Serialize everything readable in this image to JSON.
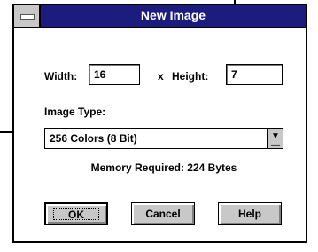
{
  "dialog": {
    "title": "New Image",
    "width": {
      "label": "Width:",
      "value": "16"
    },
    "times_sign": "x",
    "height": {
      "label": "Height:",
      "value": "7"
    },
    "image_type": {
      "label": "Image Type:",
      "selected": "256 Colors (8 Bit)"
    },
    "memory_required": "Memory Required: 224 Bytes",
    "buttons": {
      "ok": "OK",
      "cancel": "Cancel",
      "help": "Help"
    }
  },
  "icons": {
    "system_menu": "system-menu-icon",
    "dropdown": "dropdown-arrow-icon"
  },
  "colors": {
    "titlebar": "#1c1c7e",
    "title_text": "#ffffff",
    "face": "#c8c8c8"
  }
}
